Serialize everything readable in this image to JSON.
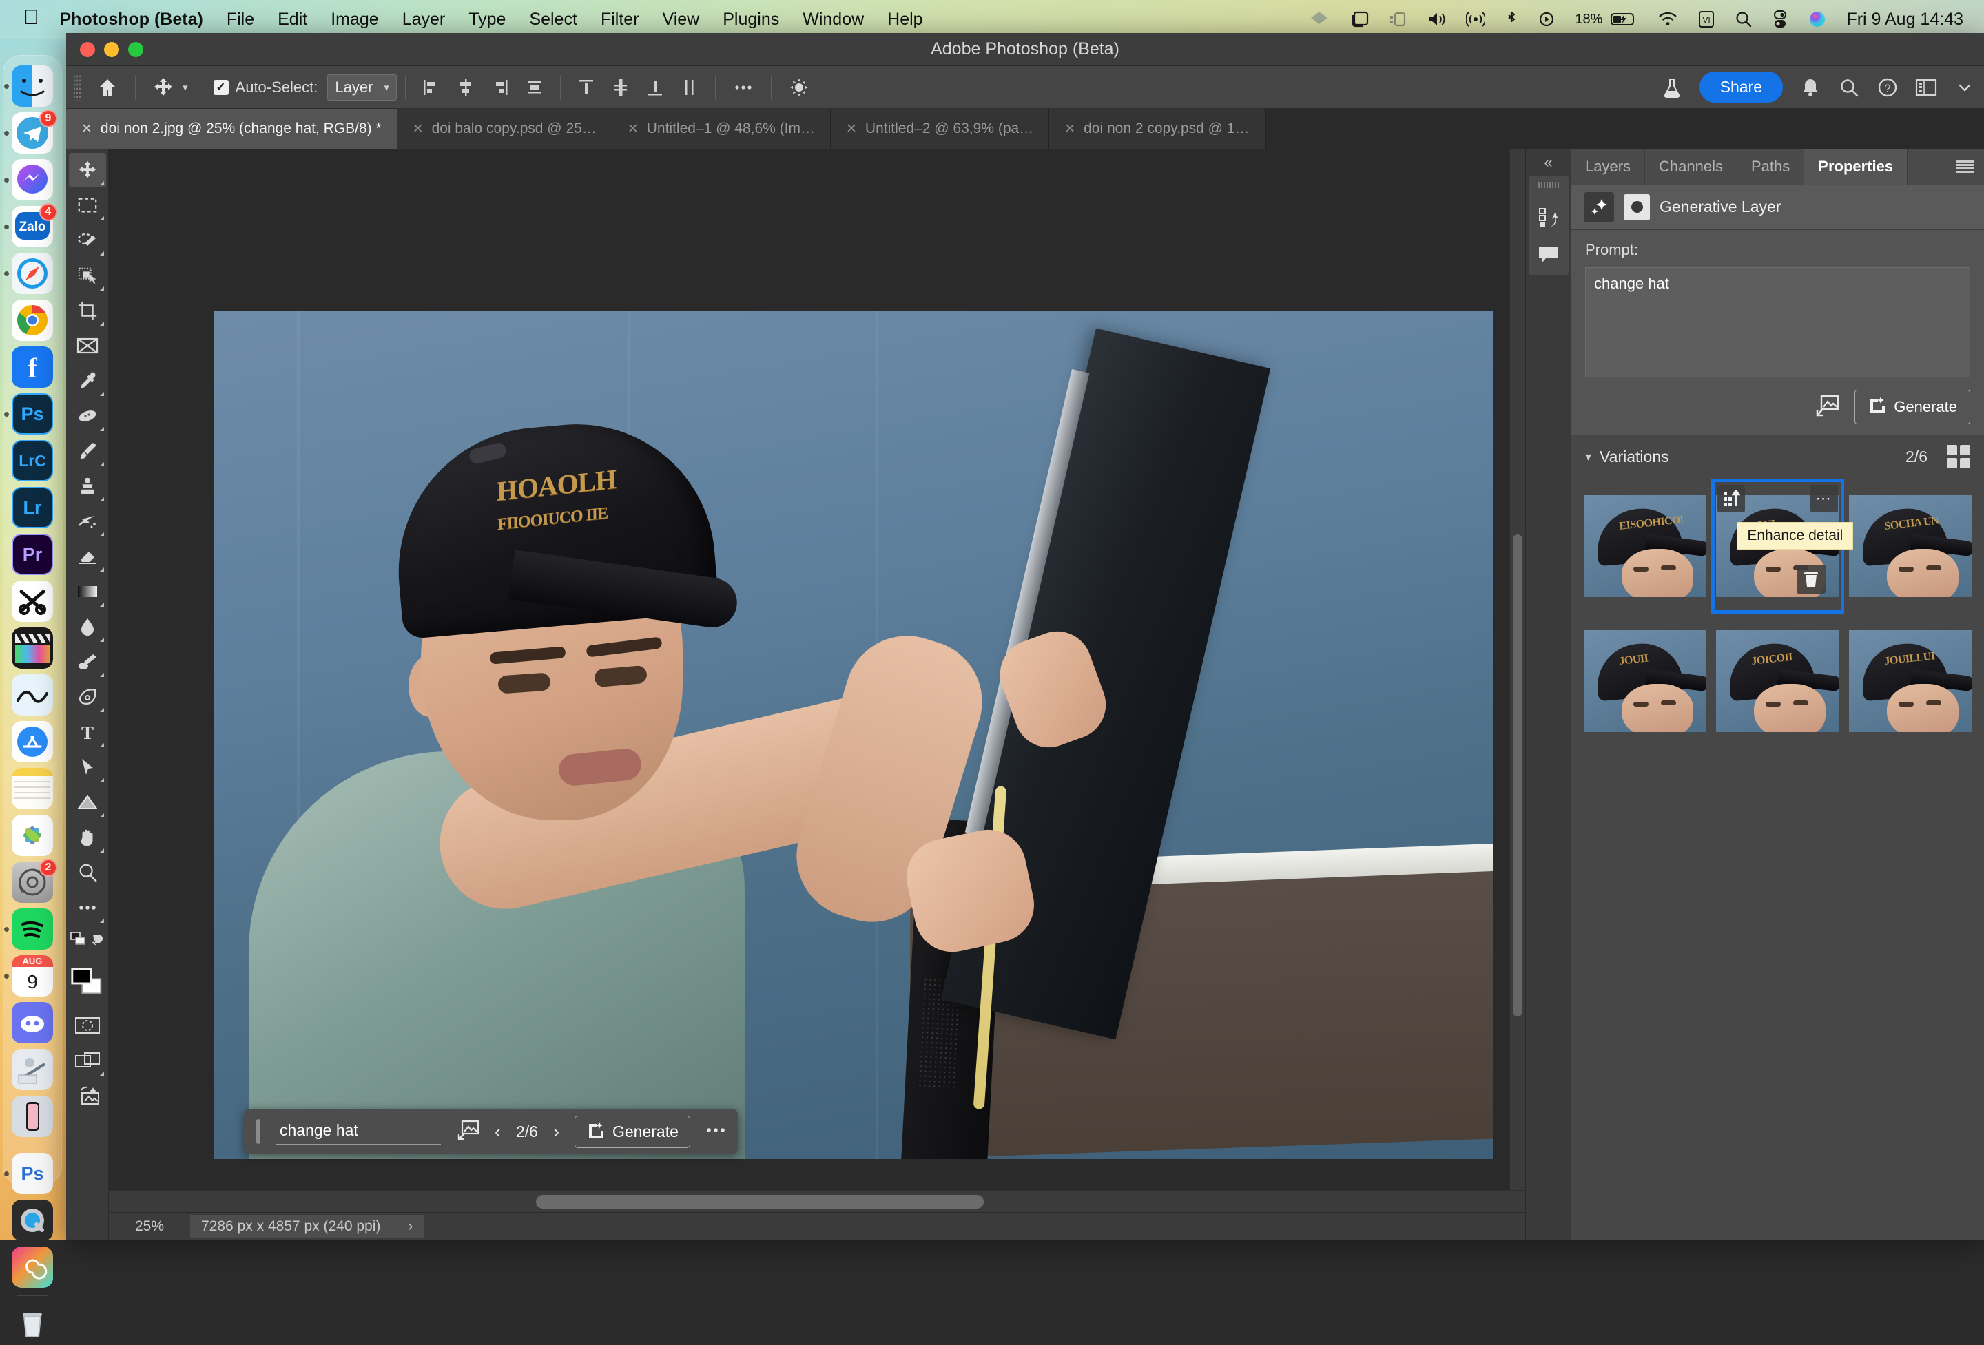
{
  "menubar": {
    "apple_icon": "apple-logo-icon",
    "items": [
      {
        "label": "Photoshop (Beta)",
        "bold": true
      },
      {
        "label": "File",
        "bold": false
      },
      {
        "label": "Edit",
        "bold": false
      },
      {
        "label": "Image",
        "bold": false
      },
      {
        "label": "Layer",
        "bold": false
      },
      {
        "label": "Type",
        "bold": false
      },
      {
        "label": "Select",
        "bold": false
      },
      {
        "label": "Filter",
        "bold": false
      },
      {
        "label": "View",
        "bold": false
      },
      {
        "label": "Plugins",
        "bold": false
      },
      {
        "label": "Window",
        "bold": false
      },
      {
        "label": "Help",
        "bold": false
      }
    ],
    "status_icons": [
      "dropbox-icon",
      "screen-mirroring-icon",
      "stage-manager-icon",
      "volume-icon",
      "airdrop-icon",
      "bluetooth-icon",
      "now-playing-icon"
    ],
    "battery_percent": "18%",
    "battery_icon": "battery-charging-icon",
    "wifi_icon": "wifi-icon",
    "input_source": "VI",
    "search_icon": "spotlight-search-icon",
    "control_center_icon": "control-center-icon",
    "siri_icon": "siri-icon",
    "clock": "Fri 9 Aug  14:43"
  },
  "dock": {
    "items": [
      {
        "name": "finder",
        "label": "Finder",
        "badge": null,
        "running": true
      },
      {
        "name": "telegram",
        "label": "Telegram",
        "badge": "9",
        "running": true
      },
      {
        "name": "messenger",
        "label": "Messenger",
        "badge": null,
        "running": true
      },
      {
        "name": "zalo",
        "label": "Zalo",
        "badge": "4",
        "running": true
      },
      {
        "name": "safari",
        "label": "Safari",
        "badge": null,
        "running": true
      },
      {
        "name": "chrome",
        "label": "Chrome",
        "badge": null,
        "running": false
      },
      {
        "name": "facebook",
        "label": "Facebook",
        "badge": null,
        "running": false
      },
      {
        "name": "photoshop-cc",
        "label": "Ps",
        "badge": null,
        "running": true
      },
      {
        "name": "lightroom-classic",
        "label": "LrC",
        "badge": null,
        "running": false
      },
      {
        "name": "lightroom",
        "label": "Lr",
        "badge": null,
        "running": false
      },
      {
        "name": "premiere-pro",
        "label": "Pr",
        "badge": null,
        "running": false
      },
      {
        "name": "capcut",
        "label": "CapCut",
        "badge": null,
        "running": false
      },
      {
        "name": "final-cut-pro",
        "label": "Final Cut Pro",
        "badge": null,
        "running": false
      },
      {
        "name": "davinci-resolve",
        "label": "DaVinci Resolve",
        "badge": null,
        "running": false
      },
      {
        "name": "app-store",
        "label": "App Store",
        "badge": null,
        "running": false
      },
      {
        "name": "notes",
        "label": "Notes",
        "badge": null,
        "running": false
      },
      {
        "name": "photos",
        "label": "Photos",
        "badge": null,
        "running": false
      },
      {
        "name": "system-settings",
        "label": "System Settings",
        "badge": "2",
        "running": false
      },
      {
        "name": "spotify",
        "label": "Spotify",
        "badge": null,
        "running": true
      },
      {
        "name": "calendar",
        "label": "9",
        "badge": null,
        "running": true,
        "sublabel": "AUG"
      },
      {
        "name": "discord",
        "label": "Discord",
        "badge": null,
        "running": false
      },
      {
        "name": "automator",
        "label": "Automator",
        "badge": null,
        "running": false
      },
      {
        "name": "iphone-mirroring",
        "label": "iPhone Mirroring",
        "badge": null,
        "running": false
      },
      {
        "name": "photoshop-beta",
        "label": "Ps",
        "badge": null,
        "running": true
      },
      {
        "name": "quicktime",
        "label": "QuickTime Player",
        "badge": null,
        "running": false
      },
      {
        "name": "creative-cloud",
        "label": "Creative Cloud",
        "badge": null,
        "running": false
      },
      {
        "name": "trash",
        "label": "Trash",
        "badge": null,
        "running": false
      }
    ]
  },
  "window": {
    "title": "Adobe Photoshop (Beta)"
  },
  "options_bar": {
    "home_icon": "home-icon",
    "tool_icon": "move-tool-icon",
    "autoselect_checked": true,
    "autoselect_label": "Auto-Select:",
    "autoselect_value": "Layer",
    "align_buttons": [
      "align-left-edges-icon",
      "align-horizontal-centers-icon",
      "align-right-edges-icon",
      "distribute-icon",
      "align-top-edges-icon",
      "align-vertical-centers-icon",
      "align-bottom-edges-icon",
      "distribute-vertical-icon"
    ],
    "more_icon": "more-options-icon",
    "settings_icon": "gear-icon",
    "lab_icon": "beta-flask-icon",
    "share_label": "Share",
    "right_icons": [
      "bell-icon",
      "search-icon",
      "help-icon",
      "workspace-icon",
      "chevron-down-icon"
    ]
  },
  "tabs": [
    {
      "label": "doi non 2.jpg @ 25% (change hat, RGB/8) *",
      "active": true
    },
    {
      "label": "doi balo copy.psd @ 25…",
      "active": false
    },
    {
      "label": "Untitled–1 @ 48,6% (Im…",
      "active": false
    },
    {
      "label": "Untitled–2 @ 63,9% (pa…",
      "active": false
    },
    {
      "label": "doi non 2 copy.psd @ 1…",
      "active": false
    }
  ],
  "toolbar": {
    "tools": [
      {
        "name": "move-tool",
        "selected": true,
        "has_flyout": true
      },
      {
        "name": "rectangular-marquee-tool",
        "selected": false,
        "has_flyout": true
      },
      {
        "name": "object-selection-tool",
        "selected": false,
        "has_flyout": true
      },
      {
        "name": "lasso-tool",
        "selected": false,
        "has_flyout": true
      },
      {
        "name": "crop-tool",
        "selected": false,
        "has_flyout": true
      },
      {
        "name": "frame-tool",
        "selected": false,
        "has_flyout": false
      },
      {
        "name": "eyedropper-tool",
        "selected": false,
        "has_flyout": true
      },
      {
        "name": "spot-healing-brush-tool",
        "selected": false,
        "has_flyout": true
      },
      {
        "name": "brush-tool",
        "selected": false,
        "has_flyout": true
      },
      {
        "name": "clone-stamp-tool",
        "selected": false,
        "has_flyout": true
      },
      {
        "name": "history-brush-tool",
        "selected": false,
        "has_flyout": true
      },
      {
        "name": "eraser-tool",
        "selected": false,
        "has_flyout": true
      },
      {
        "name": "gradient-tool",
        "selected": false,
        "has_flyout": true
      },
      {
        "name": "blur-tool",
        "selected": false,
        "has_flyout": true
      },
      {
        "name": "dodge-tool",
        "selected": false,
        "has_flyout": true
      },
      {
        "name": "pen-tool",
        "selected": false,
        "has_flyout": true
      },
      {
        "name": "type-tool",
        "selected": false,
        "has_flyout": true
      },
      {
        "name": "path-selection-tool",
        "selected": false,
        "has_flyout": true
      },
      {
        "name": "shape-tool",
        "selected": false,
        "has_flyout": true
      },
      {
        "name": "hand-tool",
        "selected": false,
        "has_flyout": true
      },
      {
        "name": "zoom-tool",
        "selected": false,
        "has_flyout": false
      },
      {
        "name": "edit-toolbar-tool",
        "selected": false,
        "has_flyout": true
      }
    ],
    "foreground_color": "#000000",
    "background_color": "#ffffff",
    "quick-mask": "quick-mask-icon",
    "screen-mode": "screen-mode-icon",
    "generative-icon": "generative-fill-icon"
  },
  "canvas": {
    "zoom": "25%",
    "dimensions": "7286 px x 4857 px (240 ppi)",
    "cap_logo_text": "HOAOLH",
    "cap_logo_text2": "FIIOOIUCO IIE"
  },
  "contextual_taskbar": {
    "prompt_value": "change hat",
    "reference_image_icon": "reference-image-icon",
    "prev_icon": "chevron-left-icon",
    "counter": "2/6",
    "next_icon": "chevron-right-icon",
    "generate_label": "Generate",
    "generate_icon": "generative-sparkle-icon",
    "more_icon": "more-options-icon"
  },
  "minidock": {
    "collapse_icon": "collapse-panels-icon",
    "icons": [
      "history-panel-icon",
      "comments-panel-icon"
    ]
  },
  "right_panel": {
    "tabs": [
      {
        "label": "Layers",
        "active": false
      },
      {
        "label": "Channels",
        "active": false
      },
      {
        "label": "Paths",
        "active": false
      },
      {
        "label": "Properties",
        "active": true
      }
    ],
    "menu_icon": "panel-menu-icon",
    "layer": {
      "generative_icon": "generative-layer-icon",
      "mask_icon": "layer-mask-icon",
      "name": "Generative Layer"
    },
    "prompt": {
      "label": "Prompt:",
      "value": "change hat",
      "reference_icon": "add-reference-image-icon",
      "generate_label": "Generate",
      "generate_icon": "generative-sparkle-icon"
    },
    "variations": {
      "chevron_icon": "chevron-down-icon",
      "title": "Variations",
      "count": "2/6",
      "grid_view_icon": "grid-view-icon",
      "tooltip": "Enhance detail",
      "thumbs": [
        {
          "index": 1,
          "selected": false,
          "cap_text": "EISOOHICODO"
        },
        {
          "index": 2,
          "selected": true,
          "cap_text": "IOUI"
        },
        {
          "index": 3,
          "selected": false,
          "cap_text": "SOCHA UN"
        },
        {
          "index": 4,
          "selected": false,
          "cap_text": "JOUII"
        },
        {
          "index": 5,
          "selected": false,
          "cap_text": "JOICOII"
        },
        {
          "index": 6,
          "selected": false,
          "cap_text": "JOUILLUI"
        }
      ],
      "thumb_actions": {
        "upscale_icon": "enhance-detail-icon",
        "more_icon": "more-options-icon",
        "delete_icon": "trash-icon"
      }
    }
  }
}
